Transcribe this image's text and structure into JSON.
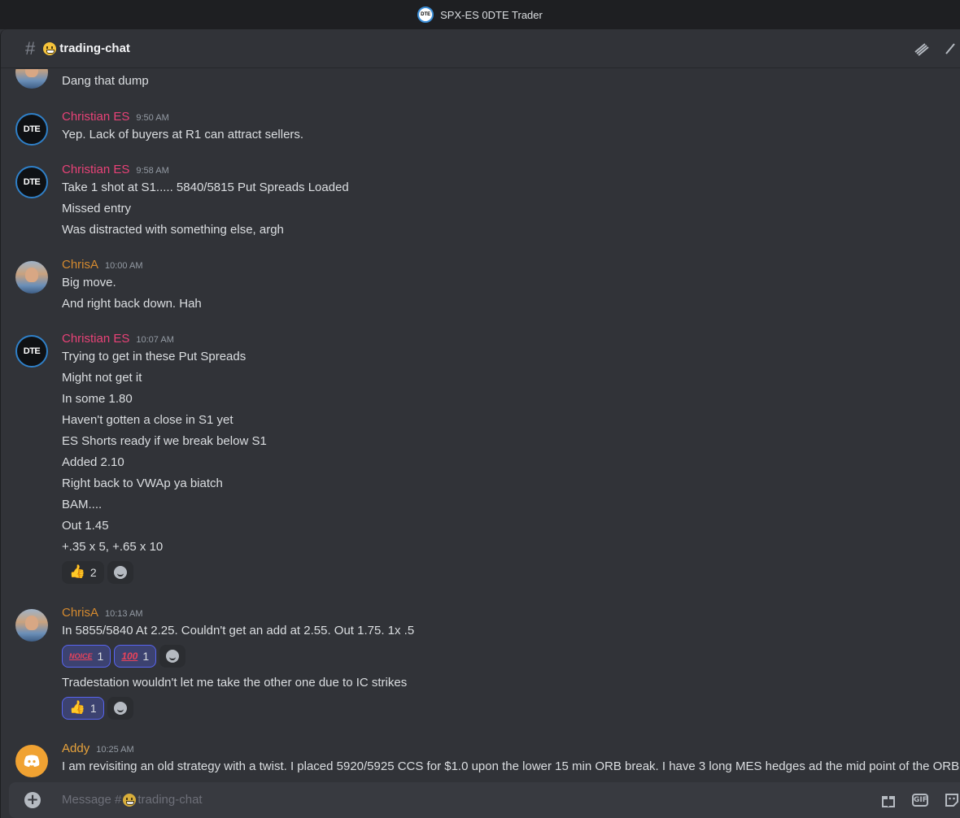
{
  "window": {
    "title": "SPX-ES 0DTE Trader",
    "logo_text": "DTE"
  },
  "channel": {
    "name": "trading-chat",
    "hash": "#"
  },
  "colors": {
    "christian": "#e84277",
    "chrisa": "#d58a2f",
    "addy": "#e8a33c",
    "background": "#313338"
  },
  "messages": {
    "top": {
      "line": "Dang that dump"
    },
    "m1": {
      "author": "Christian ES",
      "time": "9:50 AM",
      "lines": [
        "Yep. Lack of buyers at R1 can attract sellers."
      ]
    },
    "m2": {
      "author": "Christian ES",
      "time": "9:58 AM",
      "lines": [
        "Take 1 shot at S1.....   5840/5815 Put Spreads Loaded",
        "Missed entry",
        "Was distracted with something else, argh"
      ]
    },
    "m3": {
      "author": "ChrisA",
      "time": "10:00 AM",
      "lines": [
        "Big move.",
        "And right back down. Hah"
      ]
    },
    "m4": {
      "author": "Christian ES",
      "time": "10:07 AM",
      "lines": [
        "Trying to get in these Put Spreads",
        "Might not get it",
        "In some 1.80",
        "Haven't gotten a close in S1 yet",
        "ES Shorts ready if we break below S1",
        "Added 2.10",
        "Right back to VWAp ya biatch",
        "BAM....",
        "Out 1.45",
        "+.35 x 5,   +.65 x 10"
      ],
      "reaction_count": "2"
    },
    "m5": {
      "author": "ChrisA",
      "time": "10:13 AM",
      "line1": "In 5855/5840 At 2.25.   Couldn't get an add at 2.55.     Out 1.75.  1x .5",
      "reactions": [
        {
          "emoji": "NOICE",
          "count": "1"
        },
        {
          "emoji": "100",
          "count": "1"
        }
      ],
      "line2": "Tradestation wouldn't let me take the other one due to IC strikes",
      "reaction2_count": "1"
    },
    "m6": {
      "author": "Addy",
      "time": "10:25 AM",
      "lines": [
        "I am revisiting an old strategy with a twist.  I placed 5920/5925 CCS for $1.0 upon the lower 15 min ORB break.  I have 3 long MES hedges ad the mid point of the ORB"
      ]
    }
  },
  "composer": {
    "placeholder_prefix": "Message #",
    "placeholder_channel": "trading-chat"
  }
}
